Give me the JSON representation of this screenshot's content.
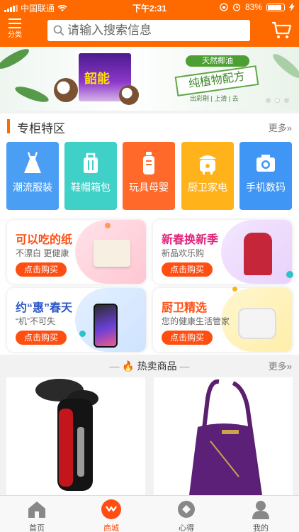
{
  "status_bar": {
    "carrier": "中国联通",
    "time": "下午2:31",
    "battery": "83%"
  },
  "header": {
    "category_label": "分类",
    "search_placeholder": "请输入搜索信息"
  },
  "banner": {
    "product_text": "韶能",
    "tag_top": "天然椰油",
    "tag_main": "纯植物配方",
    "tag_sub": "出彩刷 | 上清 | 去"
  },
  "section": {
    "title": "专柜特区",
    "more": "更多»"
  },
  "categories": [
    {
      "label": "潮流服装",
      "color": "#4a9ff5",
      "icon": "dress-icon"
    },
    {
      "label": "鞋帽箱包",
      "color": "#3fd0c8",
      "icon": "bag-icon"
    },
    {
      "label": "玩具母婴",
      "color": "#ff6a2a",
      "icon": "bottle-icon"
    },
    {
      "label": "厨卫家电",
      "color": "#ffb21a",
      "icon": "ricecooker-icon"
    },
    {
      "label": "手机数码",
      "color": "#3f96f5",
      "icon": "camera-icon"
    }
  ],
  "promos": [
    {
      "title": "可以吃的纸",
      "subtitle": "不漂白 更健康",
      "button": "点击购买",
      "title_color": "#ff4e12"
    },
    {
      "title": "新春换新季",
      "subtitle": "新品欢乐购",
      "button": "点击购买",
      "title_color": "#e0247a"
    },
    {
      "title": "约“惠”春天",
      "subtitle": "“机”不可失",
      "button": "点击购买",
      "title_color": "#2b56c9"
    },
    {
      "title": "厨卫精选",
      "subtitle": "您的健康生活管家",
      "button": "点击购买",
      "title_color": "#ff4e12"
    }
  ],
  "hot": {
    "title": "热卖商品",
    "more": "更多»"
  },
  "tabs": [
    {
      "label": "首页",
      "icon": "home-icon"
    },
    {
      "label": "商城",
      "icon": "shop-icon"
    },
    {
      "label": "心得",
      "icon": "notes-icon"
    },
    {
      "label": "我的",
      "icon": "user-icon"
    }
  ],
  "colors": {
    "brand": "#ff6a00",
    "button": "#ff4e12"
  }
}
